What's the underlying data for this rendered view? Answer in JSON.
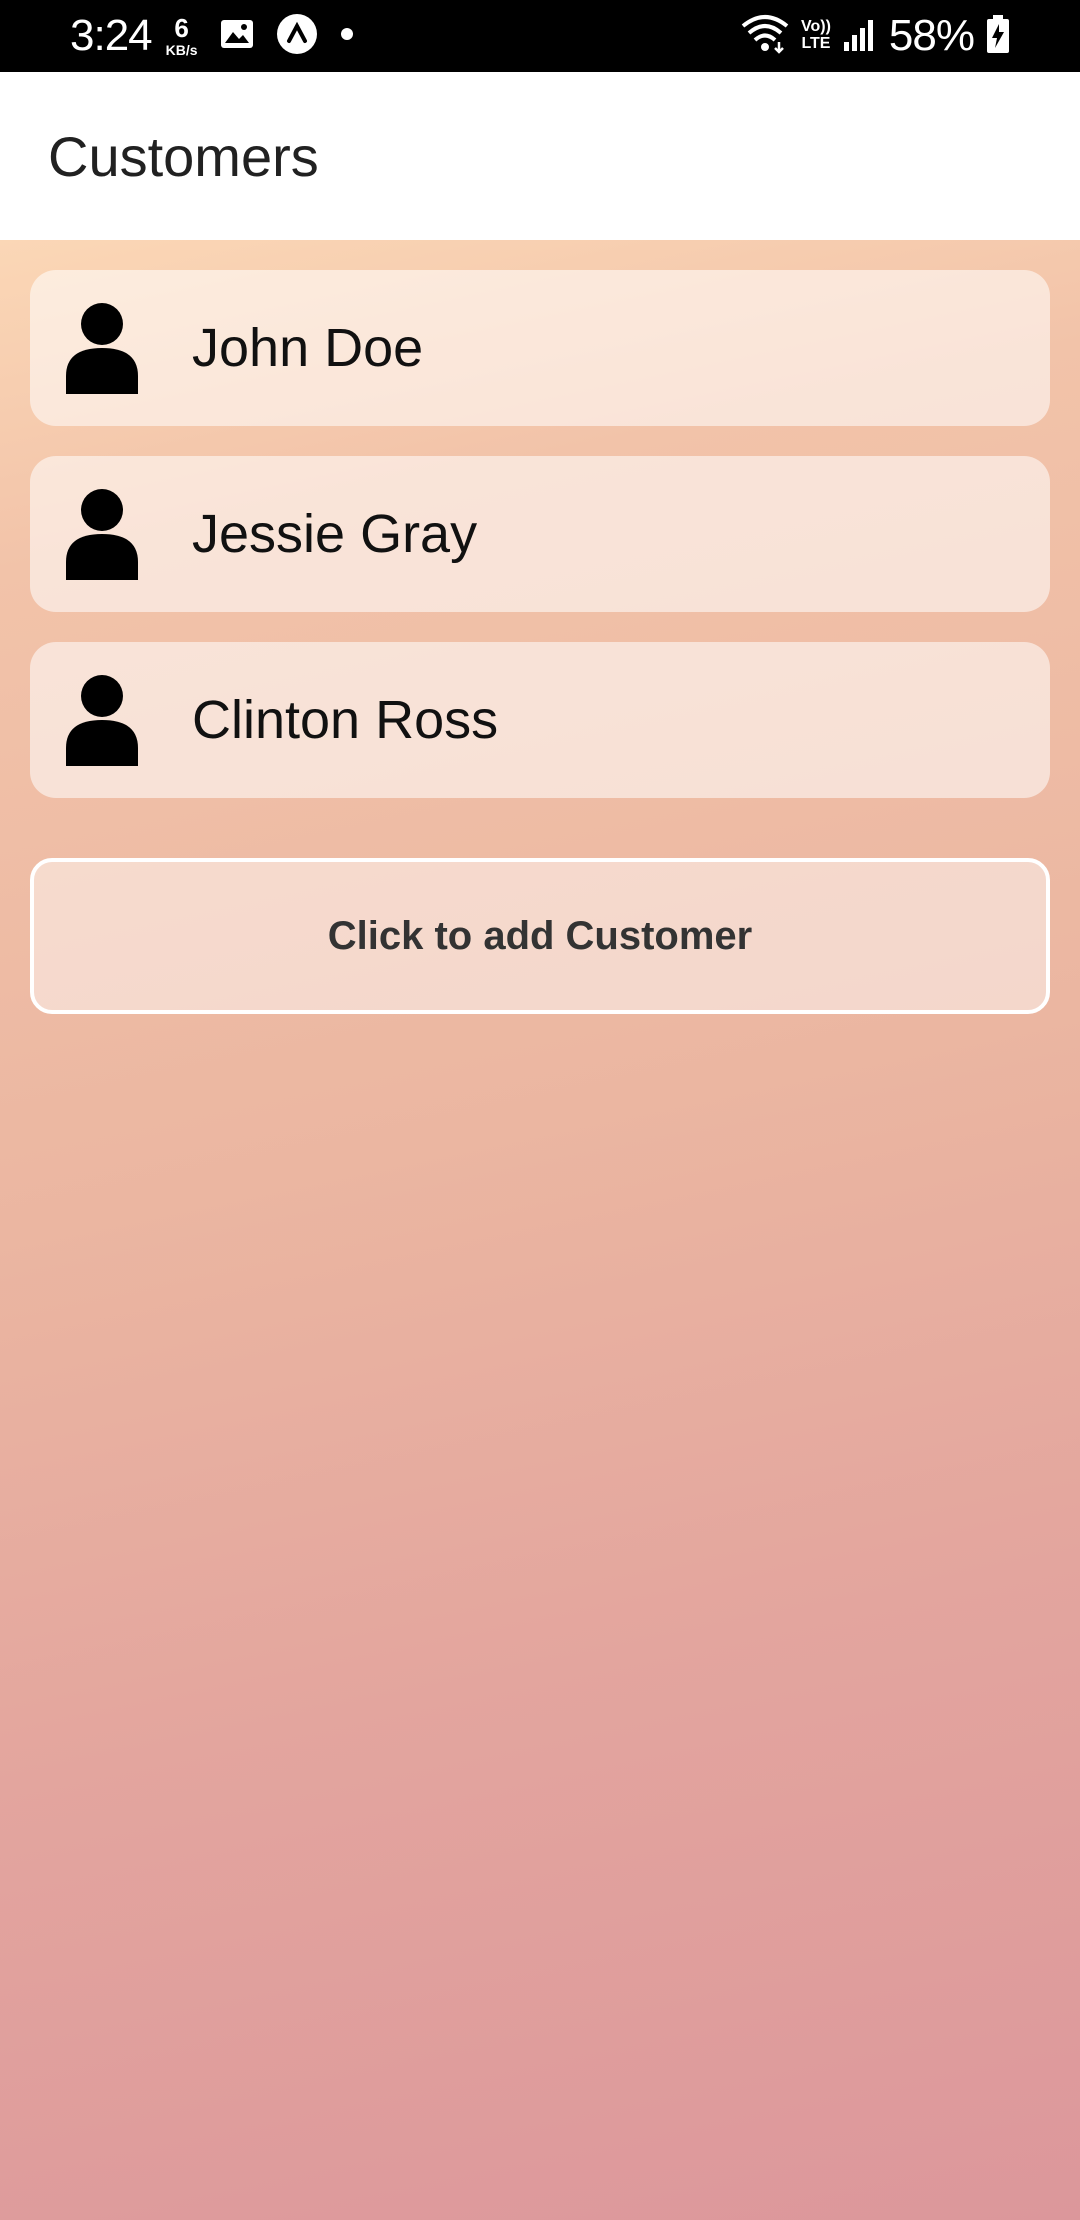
{
  "status_bar": {
    "time": "3:24",
    "net_speed_value": "6",
    "net_speed_unit": "KB/s",
    "network_type_top": "Vo))",
    "network_type_bottom": "LTE",
    "battery": "58%",
    "icons": [
      "image-icon",
      "arrow-up-circle-icon",
      "dot-icon",
      "wifi-icon",
      "signal-icon",
      "battery-charging-icon"
    ]
  },
  "app_bar": {
    "title": "Customers"
  },
  "customers": [
    {
      "name": "John Doe",
      "icon": "person-icon"
    },
    {
      "name": "Jessie Gray",
      "icon": "person-icon"
    },
    {
      "name": "Clinton Ross",
      "icon": "person-icon"
    }
  ],
  "add_button": {
    "label": "Click to add Customer"
  },
  "colors": {
    "background_top": "#fbd7b6",
    "background_bottom": "#dc979b",
    "card": "#f9e4d8",
    "text": "#111111",
    "button_border": "#ffffff"
  }
}
